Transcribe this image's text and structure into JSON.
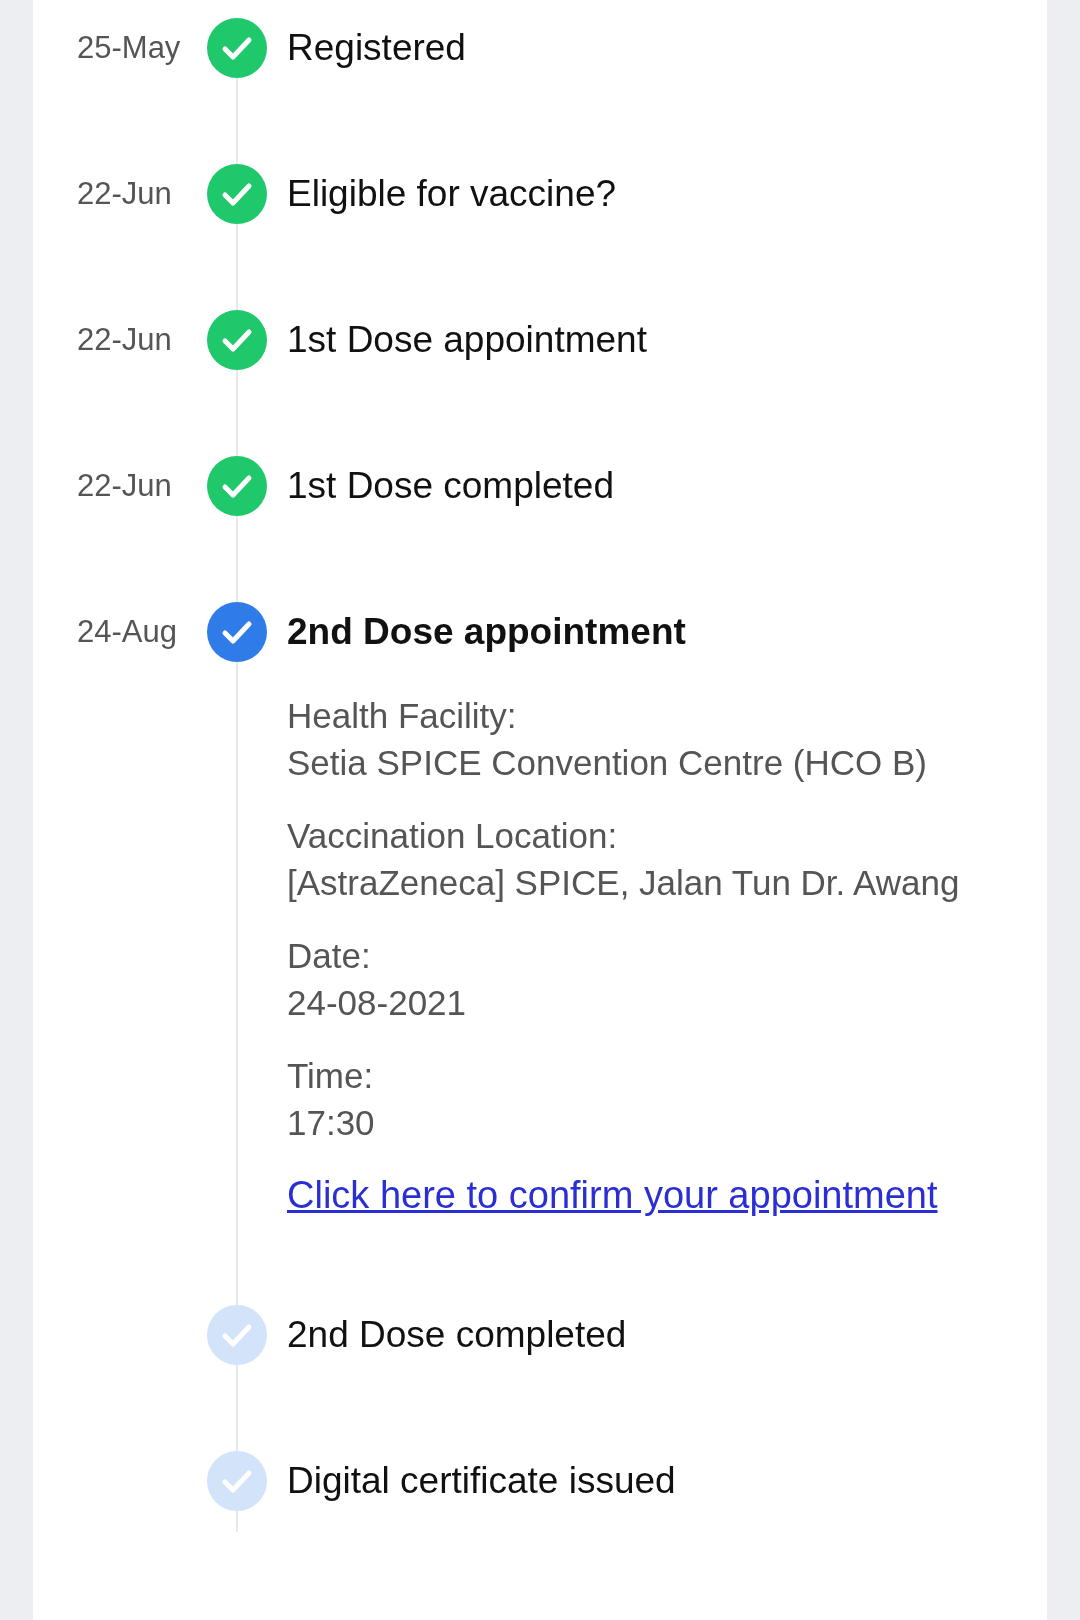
{
  "steps": [
    {
      "date": "25-May",
      "label": "Registered",
      "kind": "done"
    },
    {
      "date": "22-Jun",
      "label": "Eligible for vaccine?",
      "kind": "done"
    },
    {
      "date": "22-Jun",
      "label": "1st Dose appointment",
      "kind": "done"
    },
    {
      "date": "22-Jun",
      "label": "1st Dose completed",
      "kind": "done"
    },
    {
      "date": "24-Aug",
      "label": "2nd Dose appointment",
      "kind": "current",
      "details": [
        {
          "label": "Health Facility:",
          "value": "Setia SPICE Convention Centre (HCO B)"
        },
        {
          "label": "Vaccination Location:",
          "value": "[AstraZeneca] SPICE, Jalan Tun Dr. Awang"
        },
        {
          "label": "Date:",
          "value": "24-08-2021"
        },
        {
          "label": "Time:",
          "value": "17:30"
        }
      ],
      "link": "Click here to confirm your appointment"
    },
    {
      "label": "2nd Dose completed",
      "kind": "pending"
    },
    {
      "label": "Digital certificate issued",
      "kind": "pending"
    }
  ]
}
